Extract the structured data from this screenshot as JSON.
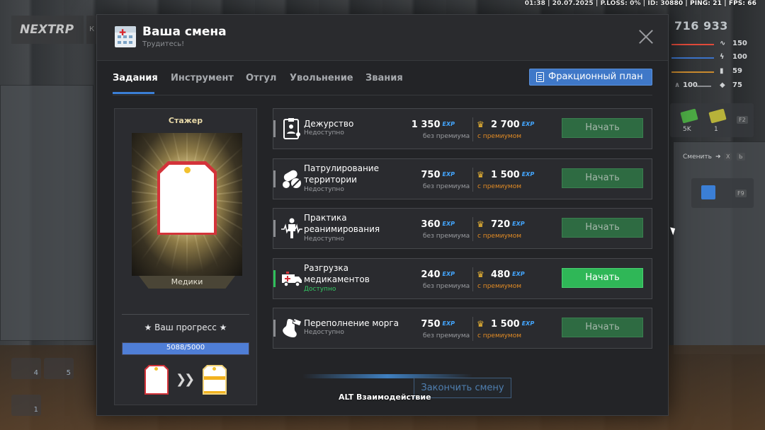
{
  "status_bar": "01:38 | 20.07.2025 | P.LOSS: 0% | ID: 30880 | PING: 21 | FPS: 66",
  "hud_left": {
    "logo": "NEXTRP",
    "logo_extra": "К",
    "slots": [
      "4",
      "5",
      "1"
    ]
  },
  "hud_right": {
    "money": "716 933",
    "stats": [
      {
        "icon": "pulse-icon",
        "value": "150",
        "color": "#e04a3a"
      },
      {
        "icon": "lightning-icon",
        "value": "100",
        "color": "#3b73c9"
      },
      {
        "icon": "drink-icon",
        "value": "59",
        "color": "#c98a2e"
      },
      {
        "icon": "shield-icon",
        "value": "75",
        "color": "#7d7f83"
      }
    ],
    "armor": "100",
    "cash": [
      "5K",
      "1"
    ],
    "fkey_1": "F2",
    "switch_label": "Сменить",
    "switch_keys": [
      "X",
      "Ь"
    ],
    "fkey_2": "F9"
  },
  "modal": {
    "title": "Ваша смена",
    "subtitle": "Трудитесь!",
    "tabs": [
      "Задания",
      "Инструмент",
      "Отгул",
      "Увольнение",
      "Звания"
    ],
    "active_tab": 0,
    "plan_button": "Фракционный план",
    "rank": {
      "name": "Стажер",
      "department": "Медики",
      "progress_label": "★ Ваш прогресс ★",
      "progress_text": "5088/5000",
      "progress_fraction": 1.0
    },
    "tasks": [
      {
        "name": "Дежурство",
        "status": "Недоступно",
        "available": false,
        "base": "1 350",
        "premium": "2 700",
        "icon": "clipboard-doctor-icon"
      },
      {
        "name": "Патрулирование территории",
        "status": "Недоступно",
        "available": false,
        "base": "750",
        "premium": "1 500",
        "icon": "pills-icon"
      },
      {
        "name": "Практика реанимирования",
        "status": "Недоступно",
        "available": false,
        "base": "360",
        "premium": "720",
        "icon": "defibrillator-icon"
      },
      {
        "name": "Разгрузка медикаментов",
        "status": "Доступно",
        "available": true,
        "base": "240",
        "premium": "480",
        "icon": "ambulance-icon"
      },
      {
        "name": "Переполнение морга",
        "status": "Недоступно",
        "available": false,
        "base": "750",
        "premium": "1 500",
        "icon": "morgue-foot-icon"
      }
    ],
    "labels": {
      "exp": "EXP",
      "no_premium": "без премиума",
      "with_premium": "с премиумом",
      "start": "Начать"
    },
    "finish_button": "Закончить смену"
  },
  "hint": "ALT Взаимодействие"
}
